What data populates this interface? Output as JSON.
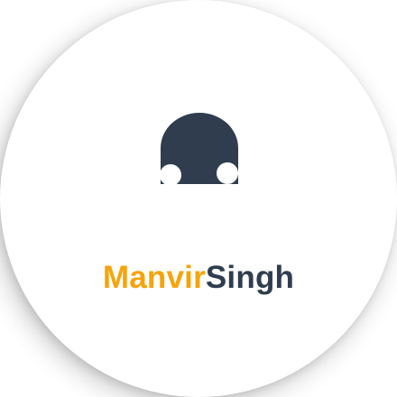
{
  "brand": {
    "first_name": "Manvir",
    "last_name": "Singh",
    "mark_icon": "mushroom-cap-icon"
  },
  "colors": {
    "accent": "#f5a40c",
    "dark": "#2f3d4f",
    "background": "#ffffff"
  }
}
